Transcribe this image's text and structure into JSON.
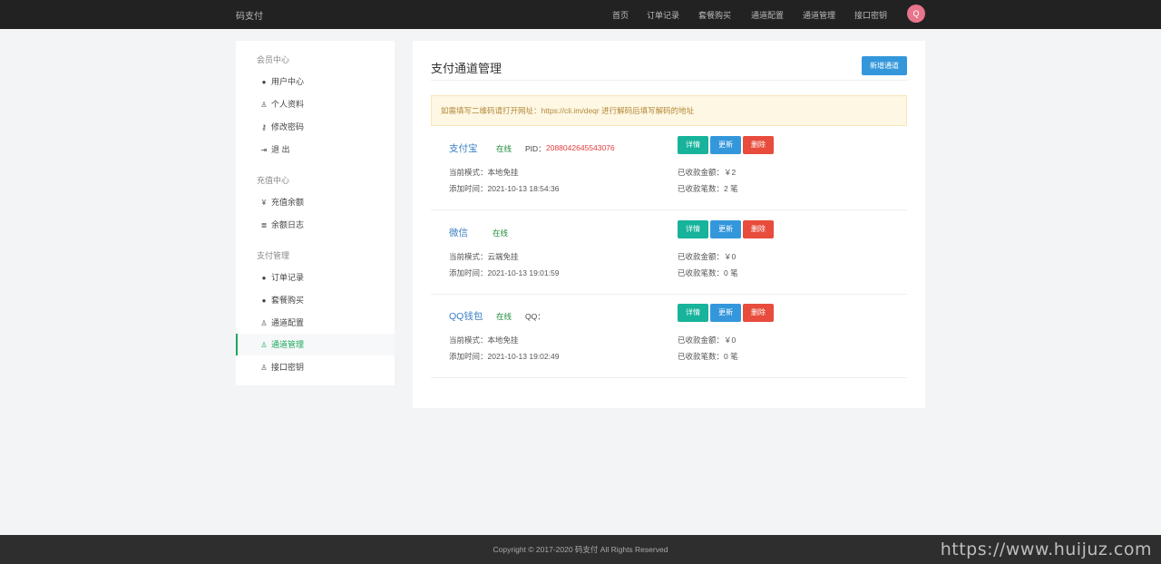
{
  "topbar": {
    "brand": "码支付",
    "nav": [
      "首页",
      "订单记录",
      "套餐购买",
      "通道配置",
      "通道管理",
      "接口密钥"
    ],
    "avatar_letter": "Q",
    "avatar_color": "#e7758b"
  },
  "sidebar": {
    "groups": [
      {
        "title": "会员中心",
        "items": [
          {
            "icon": "user-circle-icon",
            "glyph": "●",
            "label": "用户中心"
          },
          {
            "icon": "lock-icon",
            "glyph": "♙",
            "label": "个人资料"
          },
          {
            "icon": "key-icon",
            "glyph": "⚷",
            "label": "修改密码"
          },
          {
            "icon": "sign-out-icon",
            "glyph": "⇥",
            "label": "退 出"
          }
        ]
      },
      {
        "title": "充值中心",
        "items": [
          {
            "icon": "yen-icon",
            "glyph": "¥",
            "label": "充值余额"
          },
          {
            "icon": "list-icon",
            "glyph": "≣",
            "label": "余额日志"
          }
        ]
      },
      {
        "title": "支付管理",
        "items": [
          {
            "icon": "user-circle-icon",
            "glyph": "●",
            "label": "订单记录"
          },
          {
            "icon": "user-circle-icon",
            "glyph": "●",
            "label": "套餐购买"
          },
          {
            "icon": "lock-icon",
            "glyph": "♙",
            "label": "通道配置"
          },
          {
            "icon": "lock-icon",
            "glyph": "♙",
            "label": "通道管理",
            "active": true
          },
          {
            "icon": "lock-icon",
            "glyph": "♙",
            "label": "接口密钥"
          }
        ]
      }
    ]
  },
  "main": {
    "title": "支付通道管理",
    "new_button": "新增通道",
    "notice": "如需填写二维码请打开网址：https://cli.im/deqr 进行解码后填写解码的地址",
    "channels": [
      {
        "name": "支付宝",
        "status": "在线",
        "id_label": "PID：",
        "id_value": "2088042645543076",
        "mode": "当前模式：本地免挂",
        "added": "添加时间：2021-10-13 18:54:36",
        "amount": "已收款金额：￥2",
        "count": "已收款笔数：2 笔"
      },
      {
        "name": "微信",
        "status": "在线",
        "id_label": "",
        "id_value": "",
        "mode": "当前模式：云端免挂",
        "added": "添加时间：2021-10-13 19:01:59",
        "amount": "已收款金额：￥0",
        "count": "已收款笔数：0 笔"
      },
      {
        "name": "QQ钱包",
        "status": "在线",
        "id_label": "QQ：",
        "id_value": "",
        "mode": "当前模式：本地免挂",
        "added": "添加时间：2021-10-13 19:02:49",
        "amount": "已收款金额：￥0",
        "count": "已收款笔数：0 笔"
      }
    ],
    "buttons": {
      "detail": "详情",
      "update": "更新",
      "delete": "删除"
    }
  },
  "footer": "Copyright © 2017-2020 码支付 All Rights Reserved",
  "watermark": "https://www.huijuz.com",
  "colors": {
    "accent": "#1aa95d",
    "primary": "#3497db",
    "danger": "#e74c3c",
    "teal": "#17b39b"
  }
}
